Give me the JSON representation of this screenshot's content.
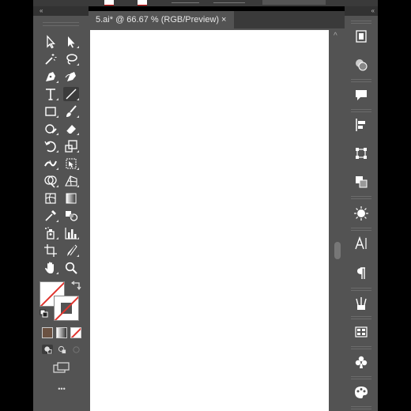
{
  "document": {
    "tab_title": "5.ai* @ 66.67 % (RGB/Preview)",
    "close_glyph": "×"
  },
  "panels": {
    "collapse_glyph": "«",
    "more_tools_glyph": "•••",
    "scroll_up_glyph": "^"
  },
  "colors": {
    "workspace": "#535353",
    "tab_bar": "#3a3a3a",
    "artboard": "#ffffff",
    "none_swatch": "#e0352f"
  },
  "tools": [
    "selection-tool-icon",
    "direct-selection-tool-icon",
    "magic-wand-tool-icon",
    "lasso-tool-icon",
    "pen-tool-icon",
    "curvature-tool-icon",
    "type-tool-icon",
    "line-segment-tool-icon",
    "rectangle-tool-icon",
    "paintbrush-tool-icon",
    "shaper-tool-icon",
    "eraser-tool-icon",
    "rotate-tool-icon",
    "scale-tool-icon",
    "width-tool-icon",
    "free-transform-tool-icon",
    "shape-builder-tool-icon",
    "perspective-grid-tool-icon",
    "mesh-tool-icon",
    "gradient-tool-icon",
    "eyedropper-tool-icon",
    "blend-tool-icon",
    "symbol-sprayer-tool-icon",
    "column-graph-tool-icon",
    "artboard-tool-icon",
    "slice-tool-icon",
    "hand-tool-icon",
    "zoom-tool-icon"
  ],
  "dock_panels": [
    "layers-panel-icon",
    "appearance-panel-icon",
    "comments-panel-icon",
    "align-panel-icon",
    "transform-panel-icon",
    "pathfinder-panel-icon",
    "color-guide-panel-icon",
    "character-panel-icon",
    "paragraph-panel-icon",
    "brushes-panel-icon",
    "swatches-panel-icon",
    "symbols-panel-icon",
    "graphic-styles-panel-icon"
  ]
}
